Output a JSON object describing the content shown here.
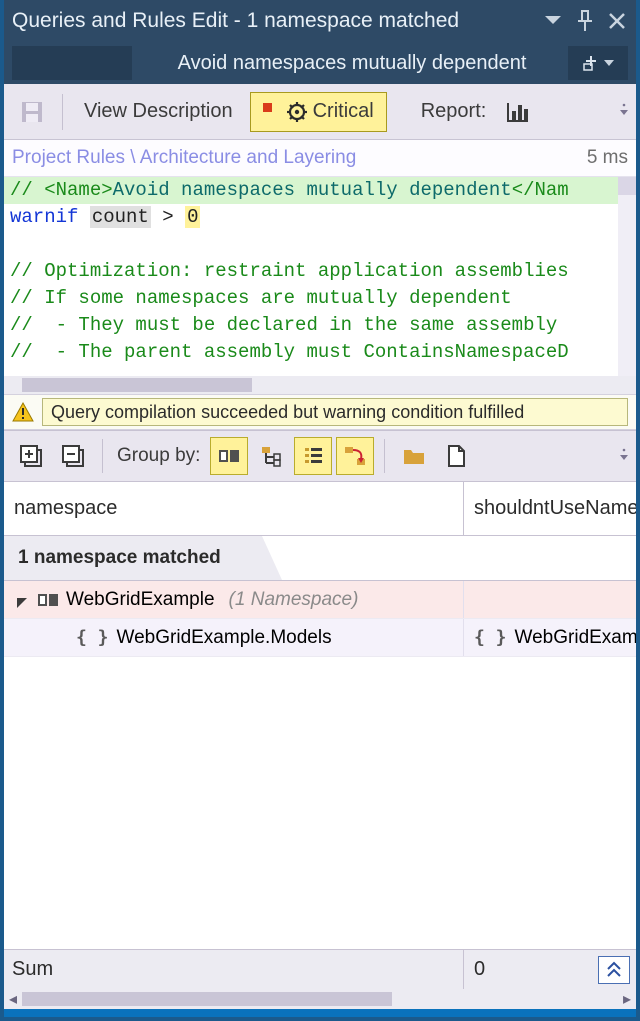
{
  "titlebar": {
    "title": "Queries and Rules Edit  - 1 namespace matched",
    "rule_name": "Avoid namespaces mutually dependent"
  },
  "toolbar": {
    "view_description": "View Description",
    "critical_label": "Critical",
    "report_label": "Report:"
  },
  "breadcrumb": {
    "path": "Project Rules \\ Architecture and Layering",
    "timing": "5 ms"
  },
  "code": {
    "l1_prefix": "// <Name>",
    "l1_name": "Avoid namespaces mutually dependent",
    "l1_suffix": "</Nam",
    "l2_warnif": "warnif",
    "l2_count": "count",
    "l2_gt": " > ",
    "l2_zero": "0",
    "l4": "// Optimization: restraint application assemblies",
    "l5": "// If some namespaces are mutually dependent",
    "l6": "//  - They must be declared in the same assembly",
    "l7": "//  - The parent assembly must ContainsNamespaceD"
  },
  "status": {
    "message": "Query compilation succeeded but warning condition fulfilled"
  },
  "results_toolbar": {
    "groupby_label": "Group by:"
  },
  "grid": {
    "col1": "namespace",
    "col2": "shouldntUseName",
    "group_label": "1 namespace matched",
    "rows": [
      {
        "name": "WebGridExample",
        "count_label": "(1 Namespace)",
        "child": {
          "c1": "WebGridExample.Models",
          "c2": "WebGridExamp"
        }
      }
    ],
    "sum_label": "Sum",
    "sum_value": "0"
  }
}
